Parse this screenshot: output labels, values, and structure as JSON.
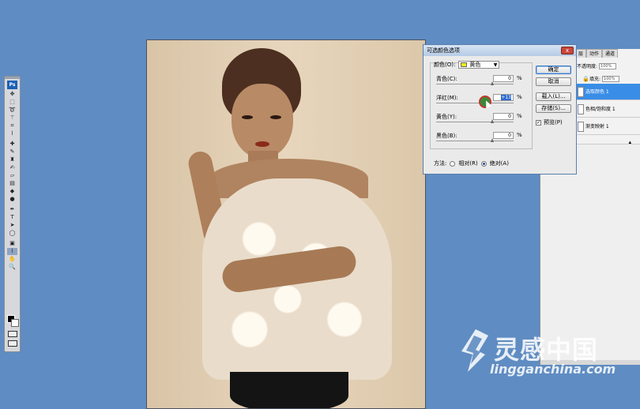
{
  "toolbox": {
    "logo": "Ps",
    "tools": [
      "move-icon",
      "marquee-icon",
      "lasso-icon",
      "magic-wand-icon",
      "crop-icon",
      "eyedropper-icon",
      "healing-icon",
      "brush-icon",
      "stamp-icon",
      "history-brush-icon",
      "eraser-icon",
      "gradient-icon",
      "blur-icon",
      "dodge-icon",
      "pen-icon",
      "type-icon",
      "path-select-icon",
      "shape-icon",
      "notes-icon",
      "eyedropper2-icon",
      "hand-icon",
      "zoom-icon"
    ]
  },
  "dialog": {
    "title": "可选颜色选项",
    "close": "x",
    "color_label": "颜色(O):",
    "color_value": "黄色",
    "sliders": [
      {
        "label": "青色(C):",
        "value": "0",
        "unit": "%"
      },
      {
        "label": "洋红(M):",
        "value": "+13",
        "unit": "%"
      },
      {
        "label": "黄色(Y):",
        "value": "0",
        "unit": "%"
      },
      {
        "label": "黑色(B):",
        "value": "0",
        "unit": "%"
      }
    ],
    "buttons": {
      "ok": "确定",
      "cancel": "取消",
      "load": "载入(L)...",
      "save": "存储(S)..."
    },
    "preview_label": "预览(P)",
    "method_label": "方法:",
    "method_relative": "相对(R)",
    "method_absolute": "绝对(A)",
    "accent_color": "#2f6bd0",
    "swatch_color": "#f2ec16"
  },
  "layers": {
    "tabs": [
      "层",
      "动作",
      "通道"
    ],
    "opacity_label": "不透明度:",
    "opacity_value": "100%",
    "fill_label": "填充:",
    "fill_value": "100%",
    "items": [
      {
        "name": "选取颜色 1"
      },
      {
        "name": "色相/饱和度 1"
      },
      {
        "name": "渐变映射 1"
      }
    ]
  },
  "watermark": {
    "text": "灵感中国",
    "url": "lingganchina.com"
  }
}
